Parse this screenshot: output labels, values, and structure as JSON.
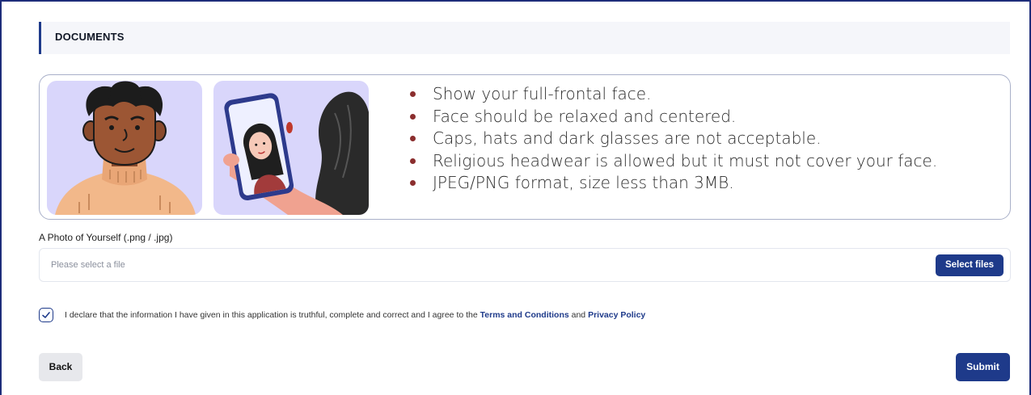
{
  "section": {
    "title": "DOCUMENTS"
  },
  "guidelines": {
    "illustrations": [
      "man-portrait-illustration",
      "selfie-phone-illustration"
    ],
    "items": [
      "Show your full-frontal face.",
      "Face should be relaxed and centered.",
      "Caps, hats and dark glasses are not acceptable.",
      "Religious headwear is allowed but it must not cover your face.",
      "JPEG/PNG format, size less than 3MB."
    ]
  },
  "photo_field": {
    "label": "A Photo of Yourself (.png / .jpg)",
    "placeholder": "Please select a file",
    "button_label": "Select files"
  },
  "declaration": {
    "checked": true,
    "text_before": "I declare that the information I have given in this application is truthful, complete and correct and I agree to the ",
    "terms_link": "Terms and Conditions",
    "text_and": " and ",
    "privacy_link": "Privacy Policy"
  },
  "actions": {
    "back_label": "Back",
    "submit_label": "Submit"
  },
  "colors": {
    "primary": "#1e3a8a",
    "illustration_bg": "#d9d6fb",
    "bullet": "#8b2e2e",
    "border": "#1e2d7a"
  }
}
